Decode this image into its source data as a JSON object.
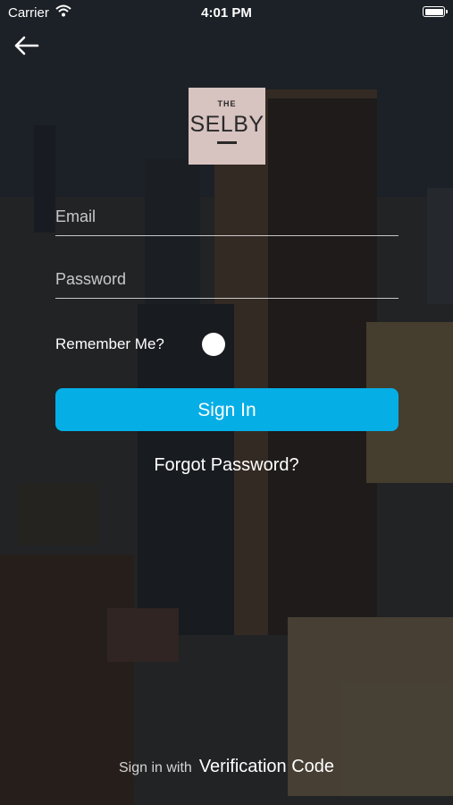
{
  "status_bar": {
    "carrier": "Carrier",
    "time": "4:01 PM"
  },
  "logo": {
    "line1": "THE",
    "line2": "SELBY"
  },
  "form": {
    "email_placeholder": "Email",
    "password_placeholder": "Password",
    "remember_label": "Remember Me?",
    "remember_checked": false,
    "sign_in_label": "Sign In",
    "forgot_label": "Forgot Password?"
  },
  "footer": {
    "prefix": "Sign in with",
    "link": "Verification Code"
  },
  "colors": {
    "accent": "#06aee6",
    "logo_bg": "#d7c3c0"
  },
  "icons": {
    "back": "arrow-left-icon",
    "wifi": "wifi-icon",
    "battery": "battery-icon"
  }
}
